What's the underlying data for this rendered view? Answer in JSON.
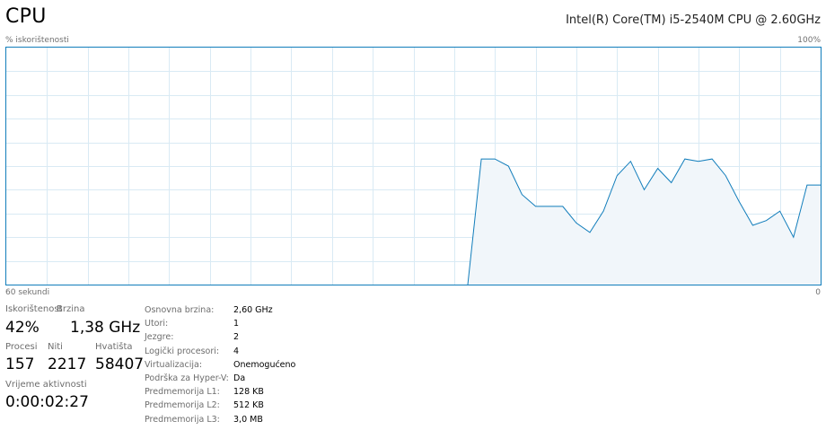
{
  "header": {
    "title": "CPU",
    "cpu_name": "Intel(R) Core(TM) i5-2540M CPU @ 2.60GHz"
  },
  "graph": {
    "label": "% iskorištenosti",
    "max_label": "100%",
    "time_label": "60 sekundi",
    "time_zero": "0",
    "line_color": "#117dbb",
    "fill_color": "#f1f6fa",
    "grid_color": "#d9eaf4"
  },
  "chart_data": {
    "type": "area",
    "x": [
      0,
      1,
      2,
      3,
      4,
      5,
      6,
      7,
      8,
      9,
      10,
      11,
      12,
      13,
      14,
      15,
      16,
      17,
      18,
      19,
      20,
      21,
      22,
      23,
      24,
      25,
      26,
      27,
      28,
      29,
      30,
      31,
      32,
      33,
      34,
      35,
      36,
      37,
      38,
      39,
      40,
      41,
      42,
      43,
      44,
      45,
      46,
      47,
      48,
      49,
      50,
      51,
      52,
      53,
      54,
      55,
      56,
      57,
      58,
      59,
      60
    ],
    "values": [
      0,
      0,
      0,
      0,
      0,
      0,
      0,
      0,
      0,
      0,
      0,
      0,
      0,
      0,
      0,
      0,
      0,
      0,
      0,
      0,
      0,
      0,
      0,
      0,
      0,
      0,
      0,
      0,
      0,
      0,
      0,
      0,
      0,
      0,
      0,
      53,
      53,
      50,
      38,
      33,
      33,
      33,
      26,
      22,
      31,
      46,
      52,
      40,
      49,
      43,
      53,
      52,
      53,
      46,
      35,
      25,
      27,
      31,
      20,
      42,
      42
    ],
    "ylim": [
      0,
      100
    ],
    "xlim": [
      0,
      60
    ],
    "grid": true
  },
  "stats": {
    "utilization": {
      "label": "Iskorištenost",
      "value": "42%"
    },
    "speed": {
      "label": "Brzina",
      "value": "1,38 GHz"
    },
    "processes": {
      "label": "Procesi",
      "value": "157"
    },
    "threads": {
      "label": "Niti",
      "value": "2217"
    },
    "handles": {
      "label": "Hvatišta",
      "value": "58407"
    },
    "uptime": {
      "label": "Vrijeme aktivnosti",
      "value": "0:00:02:27"
    }
  },
  "specs": [
    {
      "key": "Osnovna brzina:",
      "value": "2,60 GHz"
    },
    {
      "key": "Utori:",
      "value": "1"
    },
    {
      "key": "Jezgre:",
      "value": "2"
    },
    {
      "key": "Logički procesori:",
      "value": "4"
    },
    {
      "key": "Virtualizacija:",
      "value": "Onemogućeno"
    },
    {
      "key": "Podrška za Hyper-V:",
      "value": "Da"
    },
    {
      "key": "Predmemorija L1:",
      "value": "128 KB"
    },
    {
      "key": "Predmemorija L2:",
      "value": "512 KB"
    },
    {
      "key": "Predmemorija L3:",
      "value": "3,0 MB"
    }
  ]
}
